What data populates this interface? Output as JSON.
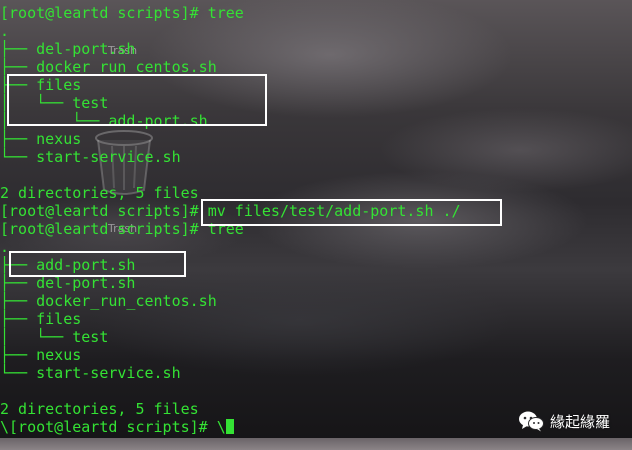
{
  "desktop": {
    "icon_labels": [
      "Trash",
      "Trash"
    ]
  },
  "terminal": {
    "lines": [
      "[root@leartd scripts]# tree",
      ".",
      "├── del-port.sh",
      "├── docker_run_centos.sh",
      "├── files",
      "│   └── test",
      "│       └── add-port.sh",
      "├── nexus",
      "└── start-service.sh",
      "",
      "2 directories, 5 files",
      "[root@leartd scripts]# mv files/test/add-port.sh ./",
      "[root@leartd scripts]# tree",
      ".",
      "├── add-port.sh",
      "├── del-port.sh",
      "├── docker_run_centos.sh",
      "├── files",
      "│   └── test",
      "├── nexus",
      "└── start-service.sh",
      "",
      "2 directories, 5 files",
      "\\[root@leartd scripts]# \\"
    ],
    "text_color": "#34e234"
  },
  "watermark": {
    "icon": "wechat-icon",
    "text": "緣起緣羅"
  },
  "colors": {
    "highlight_box": "#ffffff",
    "terminal_text": "#34e234"
  }
}
